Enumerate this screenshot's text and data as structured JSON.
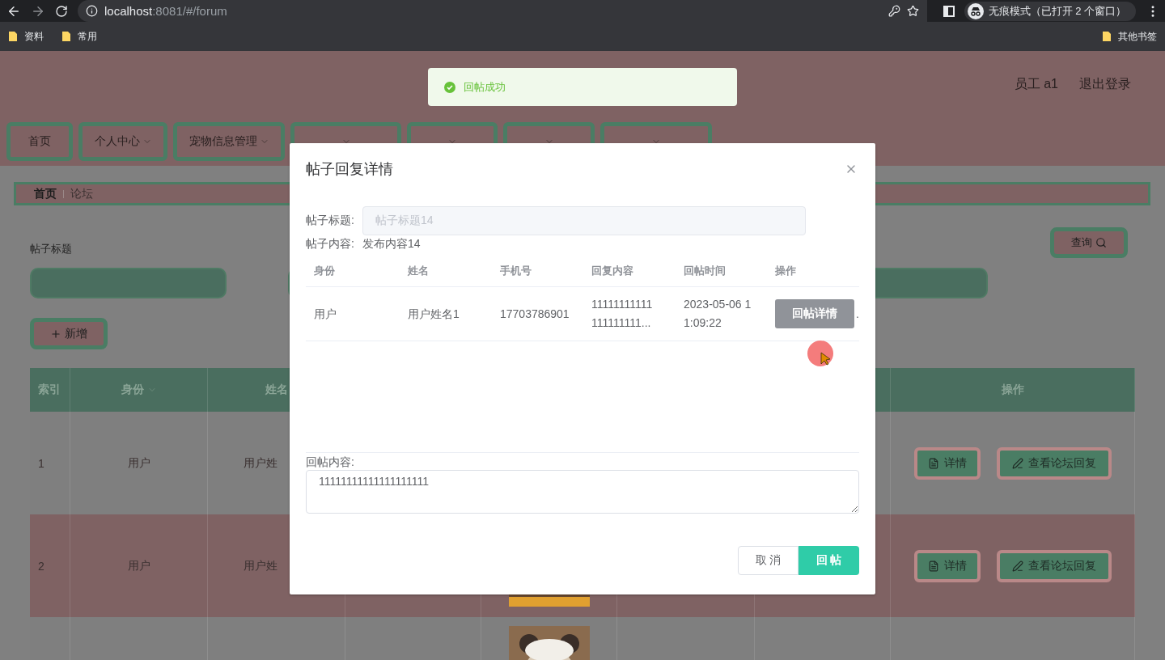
{
  "browser": {
    "url_host": "localhost",
    "url_path": ":8081/#/forum",
    "incognito_label": "无痕模式（已打开 2 个窗口）",
    "bookmarks": [
      "资料",
      "常用"
    ],
    "other_bookmarks": "其他书签"
  },
  "toast": {
    "message": "回帖成功"
  },
  "header": {
    "user": "员工 a1",
    "logout": "退出登录"
  },
  "nav": [
    {
      "label": "首页",
      "dropdown": false
    },
    {
      "label": "个人中心",
      "dropdown": true
    },
    {
      "label": "宠物信息管理",
      "dropdown": true
    },
    {
      "dropdown": true
    },
    {
      "dropdown": true
    },
    {
      "dropdown": true
    },
    {
      "dropdown": true
    }
  ],
  "breadcrumb": [
    "首页",
    "论坛"
  ],
  "search": {
    "label": "帖子标题",
    "query_button": "查询"
  },
  "add_button": "新增",
  "table": {
    "columns": [
      {
        "label": "索引"
      },
      {
        "label": "身份",
        "sortable": true
      },
      {
        "label": "姓名"
      },
      {
        "label": "操作"
      }
    ],
    "rows": [
      {
        "index": "1",
        "identity": "用户",
        "name": "用户姓",
        "actions": [
          "详情",
          "查看论坛回复"
        ]
      },
      {
        "index": "2",
        "identity": "用户",
        "name": "用户姓",
        "image": {
          "kind": "picture"
        },
        "actions": [
          "详情",
          "查看论坛回复"
        ]
      },
      {
        "image": {
          "kind": "picture"
        }
      }
    ]
  },
  "dialog": {
    "title": "帖子回复详情",
    "post_title_label": "帖子标题:",
    "post_title_value": "帖子标题14",
    "post_content_label": "帖子内容:",
    "post_content_value": "发布内容14",
    "columns": [
      "身份",
      "姓名",
      "手机号",
      "回复内容",
      "回帖时间",
      "操作"
    ],
    "rows": [
      {
        "identity": "用户",
        "name": "用户姓名1",
        "phone": "17703786901",
        "reply_lines": [
          "11111111111",
          "111111111..."
        ],
        "time_lines": [
          "2023-05-06 1",
          "1:09:22"
        ],
        "action": "回帖详情",
        "overflow": "."
      }
    ],
    "reply_label": "回帖内容:",
    "reply_value": "11111111111111111111",
    "cancel": "取 消",
    "submit": "回 帖"
  }
}
